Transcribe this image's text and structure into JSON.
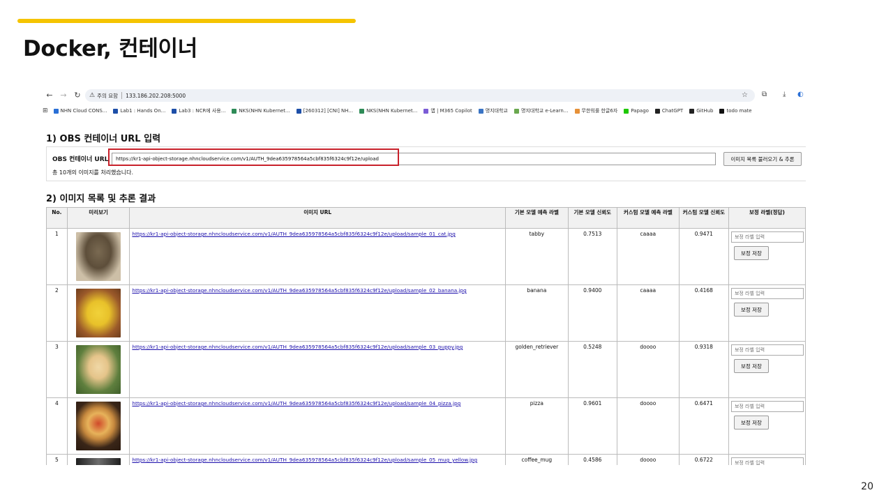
{
  "slide": {
    "title": "Docker, 컨테이너",
    "page_number": "20",
    "accent_color": "#f5c400",
    "highlight_color": "#c8202a"
  },
  "browser": {
    "security_warning": "주의 요함",
    "address": "133.186.202.208:5000",
    "bookmarks": [
      {
        "label": "NHN Cloud CONS...",
        "color": "#2a6fd6"
      },
      {
        "label": "Lab1 : Hands On...",
        "color": "#1d4fa8"
      },
      {
        "label": "Lab3 : NCR에 사용...",
        "color": "#1d4fa8"
      },
      {
        "label": "NKS(NHN Kubernet...",
        "color": "#2e8b57"
      },
      {
        "label": "[260312] [CNI] NH...",
        "color": "#1d4fa8"
      },
      {
        "label": "NKS(NHN Kubernet...",
        "color": "#2e8b57"
      },
      {
        "label": "앱 | M365 Copilot",
        "color": "#7b5cd6"
      },
      {
        "label": "명지대학교",
        "color": "#3a74c4"
      },
      {
        "label": "명지대학교 e-Learn...",
        "color": "#6aa84f"
      },
      {
        "label": "무한워룰 한글6자",
        "color": "#e69138"
      },
      {
        "label": "Papago",
        "color": "#1ec800"
      },
      {
        "label": "ChatGPT",
        "color": "#222222"
      },
      {
        "label": "GitHub",
        "color": "#222222"
      },
      {
        "label": "todo mate",
        "color": "#111111"
      }
    ]
  },
  "section1": {
    "title": "1) OBS 컨테이너 URL 입력",
    "label": "OBS 컨테이너 URL",
    "url_value": "https://kr1-api-object-storage.nhncloudservice.com/v1/AUTH_9dea635978564a5cbf835f6324c9f12e/upload",
    "button": "이미지 목록 불러오기 & 추론",
    "status": "총 10개의 이미지를 처리했습니다."
  },
  "section2": {
    "title": "2) 이미지 목록 및 추론 결과",
    "headers": [
      "No.",
      "미리보기",
      "이미지 URL",
      "기본 모델 예측 라벨",
      "기본 모델 신뢰도",
      "커스텀 모델 예측 라벨",
      "커스텀 모델 신뢰도",
      "보정 라벨(정답)"
    ],
    "correction_placeholder": "보정 라벨 입력",
    "save_label": "보정 저장",
    "rows": [
      {
        "no": "1",
        "url": "https://kr1-api-object-storage.nhncloudservice.com/v1/AUTH_9dea635978564a5cbf835f6324c9f12e/upload/sample_01_cat.jpg",
        "base_label": "tabby",
        "base_conf": "0.7513",
        "custom_label": "caaaa",
        "custom_conf": "0.9471"
      },
      {
        "no": "2",
        "url": "https://kr1-api-object-storage.nhncloudservice.com/v1/AUTH_9dea635978564a5cbf835f6324c9f12e/upload/sample_02_banana.jpg",
        "base_label": "banana",
        "base_conf": "0.9400",
        "custom_label": "caaaa",
        "custom_conf": "0.4168"
      },
      {
        "no": "3",
        "url": "https://kr1-api-object-storage.nhncloudservice.com/v1/AUTH_9dea635978564a5cbf835f6324c9f12e/upload/sample_03_puppy.jpg",
        "base_label": "golden_retriever",
        "base_conf": "0.5248",
        "custom_label": "doooo",
        "custom_conf": "0.9318"
      },
      {
        "no": "4",
        "url": "https://kr1-api-object-storage.nhncloudservice.com/v1/AUTH_9dea635978564a5cbf835f6324c9f12e/upload/sample_04_pizza.jpg",
        "base_label": "pizza",
        "base_conf": "0.9601",
        "custom_label": "doooo",
        "custom_conf": "0.6471"
      },
      {
        "no": "5",
        "url": "https://kr1-api-object-storage.nhncloudservice.com/v1/AUTH_9dea635978564a5cbf835f6324c9f12e/upload/sample_05_mug_yellow.jpg",
        "base_label": "coffee_mug",
        "base_conf": "0.4586",
        "custom_label": "doooo",
        "custom_conf": "0.6722"
      }
    ]
  }
}
